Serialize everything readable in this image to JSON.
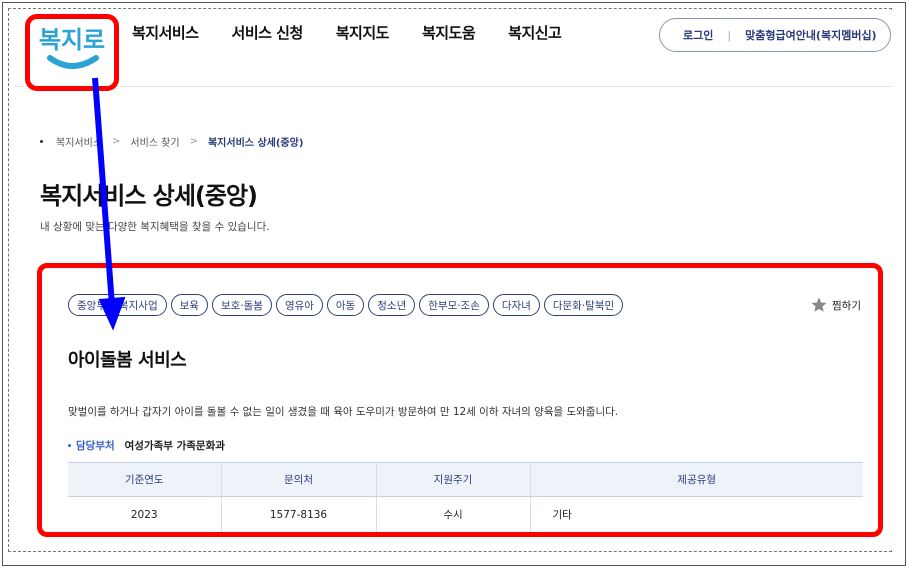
{
  "header": {
    "logo_text": "복지로",
    "nav": [
      "복지서비스",
      "서비스 신청",
      "복지지도",
      "복지도움",
      "복지신고"
    ],
    "login_label": "로그인",
    "separator": "|",
    "membership_label": "맞춤형급여안내(복지멤버십)"
  },
  "breadcrumb": {
    "items": [
      "복지서비스",
      "서비스 찾기"
    ],
    "current": "복지서비스 상세(중앙)"
  },
  "page": {
    "title": "복지서비스 상세(중앙)",
    "subtitle": "내 상황에 맞는 다양한 복지혜택을 찾을 수 있습니다."
  },
  "service": {
    "tags": [
      "중앙부처 복지사업",
      "보육",
      "보호·돌봄",
      "영유아",
      "아동",
      "청소년",
      "한부모·조손",
      "다자녀",
      "다문화·탈북민"
    ],
    "bookmark_label": "찜하기",
    "title": "아이돌봄 서비스",
    "description": "맞벌이를 하거나 갑자기 아이를 돌볼 수 없는 일이 생겼을 때 육아 도우미가 방문하여 만 12세 이하 자녀의 양육을 도와줍니다.",
    "dept_label": "담당부처",
    "dept_value": "여성가족부 가족문화과",
    "table": {
      "headers": [
        "기준연도",
        "문의처",
        "지원주기",
        "제공유형"
      ],
      "row": [
        "2023",
        "1577-8136",
        "수시",
        "기타"
      ]
    }
  },
  "colors": {
    "brand": "#2e3f7a",
    "accent": "#3a61c8",
    "highlight": "#ff0000",
    "annotation_arrow": "#0000ff"
  }
}
